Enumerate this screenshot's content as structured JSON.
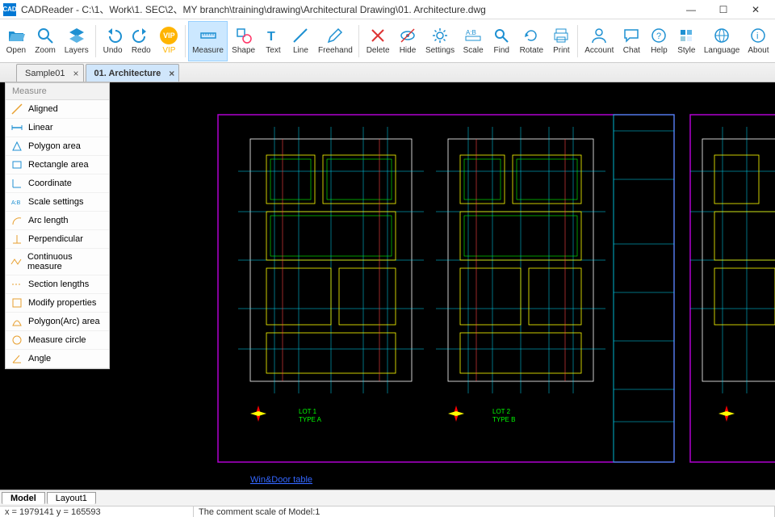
{
  "window": {
    "app": "CAD",
    "title": "CADReader - C:\\1、Work\\1. SEC\\2、MY branch\\training\\drawing\\Architectural Drawing\\01. Architecture.dwg"
  },
  "toolbar": {
    "open": "Open",
    "zoom": "Zoom",
    "layers": "Layers",
    "undo": "Undo",
    "redo": "Redo",
    "vip": "VIP",
    "measure": "Measure",
    "shape": "Shape",
    "text": "Text",
    "line": "Line",
    "freehand": "Freehand",
    "delete": "Delete",
    "hide": "Hide",
    "settings": "Settings",
    "scale": "Scale",
    "find": "Find",
    "rotate": "Rotate",
    "print": "Print",
    "account": "Account",
    "chat": "Chat",
    "help": "Help",
    "style": "Style",
    "language": "Language",
    "about": "About"
  },
  "file_tabs": [
    {
      "label": "Sample01",
      "active": false
    },
    {
      "label": "01. Architecture",
      "active": true
    }
  ],
  "measure_panel": {
    "header": "Measure",
    "items": [
      "Aligned",
      "Linear",
      "Polygon area",
      "Rectangle area",
      "Coordinate",
      "Scale settings",
      "Arc length",
      "Perpendicular",
      "Continuous measure",
      "Section lengths",
      "Modify properties",
      "Polygon(Arc) area",
      "Measure circle",
      "Angle"
    ]
  },
  "canvas": {
    "link_text": "Win&Door table"
  },
  "model_tabs": {
    "model": "Model",
    "layout1": "Layout1"
  },
  "status": {
    "coords": "x = 1979141 y = 165593",
    "comment": "The comment scale of Model:1"
  },
  "colors": {
    "accent": "#0088d1",
    "vip": "#ffb400"
  }
}
